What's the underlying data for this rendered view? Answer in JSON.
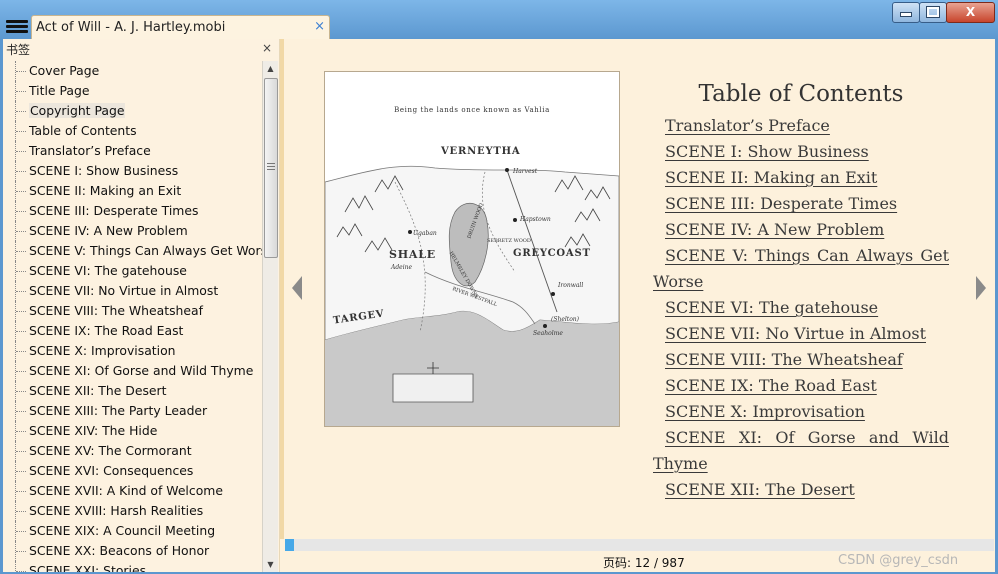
{
  "window": {
    "tab_title": "Act of Will - A. J. Hartley.mobi",
    "tab_close": "×",
    "close_glyph": "X"
  },
  "sidebar": {
    "header": "书签",
    "close": "×",
    "items": [
      {
        "label": "Cover Page"
      },
      {
        "label": "Title Page"
      },
      {
        "label": "Copyright Page",
        "selected": true
      },
      {
        "label": "Table of Contents"
      },
      {
        "label": "Translator’s Preface"
      },
      {
        "label": "SCENE I: Show Business"
      },
      {
        "label": "SCENE II: Making an Exit"
      },
      {
        "label": "SCENE III: Desperate Times"
      },
      {
        "label": "SCENE IV: A New Problem"
      },
      {
        "label": "SCENE V: Things Can Always Get Worse"
      },
      {
        "label": "SCENE VI: The gatehouse"
      },
      {
        "label": "SCENE VII: No Virtue in Almost"
      },
      {
        "label": "SCENE VIII: The Wheatsheaf"
      },
      {
        "label": "SCENE IX: The Road East"
      },
      {
        "label": "SCENE X: Improvisation"
      },
      {
        "label": "SCENE XI: Of Gorse and Wild Thyme"
      },
      {
        "label": "SCENE XII: The Desert"
      },
      {
        "label": "SCENE XIII: The Party Leader"
      },
      {
        "label": "SCENE XIV: The Hide"
      },
      {
        "label": "SCENE XV: The Cormorant"
      },
      {
        "label": "SCENE XVI: Consequences"
      },
      {
        "label": "SCENE XVII: A Kind of Welcome"
      },
      {
        "label": "SCENE XVIII: Harsh Realities"
      },
      {
        "label": "SCENE XIX: A Council Meeting"
      },
      {
        "label": "SCENE XX: Beacons of Honor"
      },
      {
        "label": "SCENE XXI: Stories"
      }
    ]
  },
  "map": {
    "caption": "Being the lands once known as Vahlia",
    "regions": {
      "verneytha": "VERNEYTHA",
      "shale": "SHALE",
      "greycoast": "GREYCOAST",
      "targev": "TARGEV"
    },
    "places": {
      "harvest": "Harvest",
      "hapstown": "Hapstown",
      "ugaban": "Ugaban",
      "adeine": "Adeine",
      "ironwall": "Ironwall",
      "shelton": "(Shelton)",
      "seaholme": "Seaholme",
      "druin_wood": "DRUIN WOOD",
      "sebretz_wood": "SEBRETZ WOOD",
      "helmsley_downs": "HELMSLEY DOWNS",
      "river_westfall": "RIVER WESTFALL"
    }
  },
  "book": {
    "heading": "Table of Contents",
    "entries": [
      "Translator’s Preface",
      "SCENE I: Show Business",
      "SCENE II: Making an Exit",
      "SCENE III: Desperate Times",
      "SCENE IV: A New Problem",
      "SCENE V: Things Can Always Get Worse",
      "SCENE VI: The gatehouse",
      "SCENE VII: No Virtue in Almost",
      "SCENE VIII: The Wheatsheaf",
      "SCENE IX: The Road East",
      "SCENE X: Improvisation",
      "SCENE XI: Of Gorse and Wild Thyme",
      "SCENE XII: The Desert"
    ]
  },
  "progress": {
    "fraction": 0.012
  },
  "status": {
    "page_indicator": "页码: 12 / 987",
    "watermark": "CSDN @grey_csdn"
  },
  "colors": {
    "page_bg": "#fdf1dc",
    "progress_fill": "#46a8e8",
    "window_blue": "#5b97cf"
  }
}
